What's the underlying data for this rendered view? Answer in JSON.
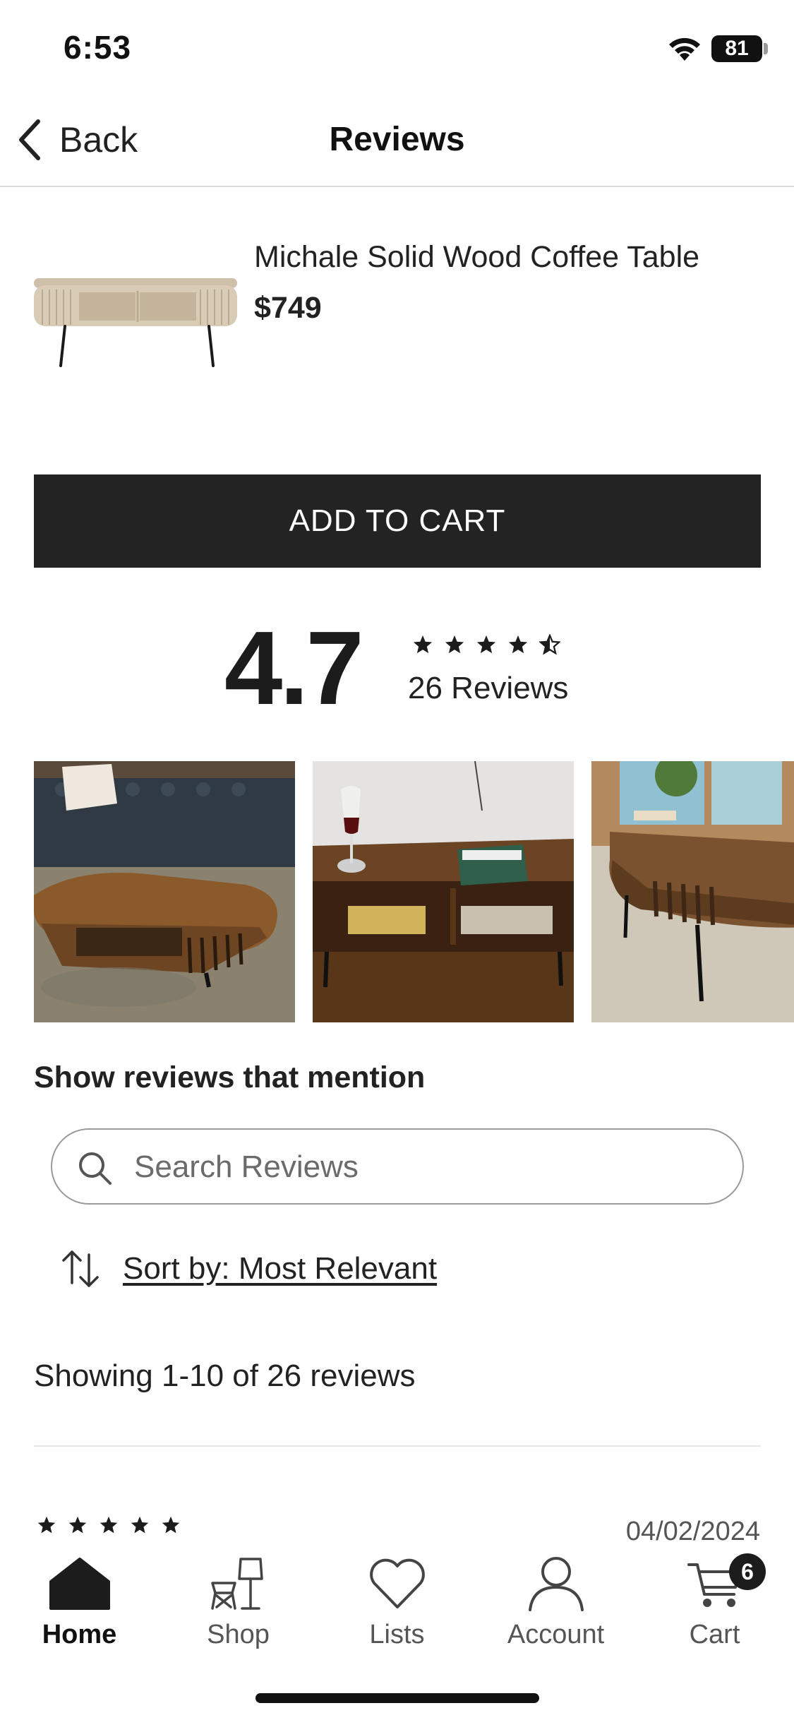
{
  "status_bar": {
    "time": "6:53",
    "battery": "81"
  },
  "nav": {
    "back_label": "Back",
    "title": "Reviews"
  },
  "product": {
    "name": "Michale Solid Wood Coffee Table",
    "price": "$749"
  },
  "add_to_cart_label": "ADD TO CART",
  "rating": {
    "score": "4.7",
    "stars": 4.5,
    "count_label": "26 Reviews"
  },
  "photos": [
    "review-photo",
    "review-photo",
    "review-photo"
  ],
  "mention": {
    "heading": "Show reviews that mention"
  },
  "search": {
    "placeholder": "Search Reviews"
  },
  "sort": {
    "label": "Sort by: Most Relevant"
  },
  "showing_label": "Showing 1-10 of 26 reviews",
  "first_review": {
    "stars": 5,
    "date": "04/02/2024"
  },
  "tabs": [
    {
      "label": "Home",
      "icon": "home-icon",
      "active": true
    },
    {
      "label": "Shop",
      "icon": "shop-icon",
      "active": false
    },
    {
      "label": "Lists",
      "icon": "heart-icon",
      "active": false
    },
    {
      "label": "Account",
      "icon": "account-icon",
      "active": false
    },
    {
      "label": "Cart",
      "icon": "cart-icon",
      "active": false
    }
  ],
  "cart_badge": "6",
  "colors": {
    "button_bg": "#232323",
    "text": "#222222",
    "muted": "#555555"
  }
}
